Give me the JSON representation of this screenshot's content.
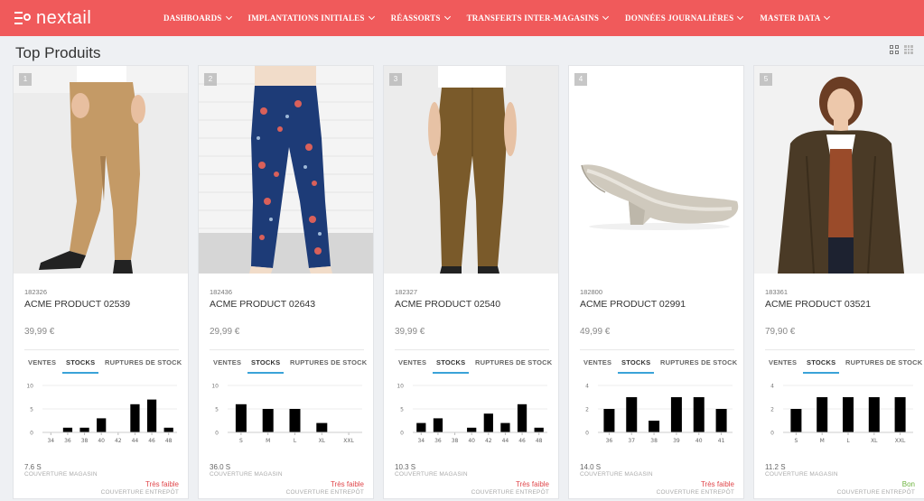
{
  "brand": {
    "name": "nextail"
  },
  "nav": [
    {
      "label": "DASHBOARDS"
    },
    {
      "label": "IMPLANTATIONS INITIALES"
    },
    {
      "label": "RÉASSORTS"
    },
    {
      "label": "TRANSFERTS INTER-MAGASINS"
    },
    {
      "label": "DONNÉES JOURNALIÈRES"
    },
    {
      "label": "MASTER DATA"
    }
  ],
  "page": {
    "title": "Top Produits"
  },
  "view_icons": [
    "grid-view-icon",
    "list-view-icon"
  ],
  "tab_labels": {
    "sales": "VENTES",
    "stocks": "STOCKS",
    "ruptures": "RUPTURES DE STOCK"
  },
  "labels": {
    "store_coverage": "COUVERTURE MAGASIN",
    "warehouse_coverage": "COUVERTURE ENTREPÔT"
  },
  "colors": {
    "brand": "#f05a5b",
    "tab_active": "#3aa3d8",
    "status_low": "#e0474b",
    "status_good": "#6db33f"
  },
  "products": [
    {
      "rank": "1",
      "sku": "182326",
      "name": "ACME PRODUCT 02539",
      "price": "39,99 €",
      "coverage": "7.6 S",
      "status": "Très faible",
      "status_color": "#e0474b"
    },
    {
      "rank": "2",
      "sku": "182436",
      "name": "ACME PRODUCT 02643",
      "price": "29,99 €",
      "coverage": "36.0 S",
      "status": "Très faible",
      "status_color": "#e0474b"
    },
    {
      "rank": "3",
      "sku": "182327",
      "name": "ACME PRODUCT 02540",
      "price": "39,99 €",
      "coverage": "10.3 S",
      "status": "Très faible",
      "status_color": "#e0474b"
    },
    {
      "rank": "4",
      "sku": "182800",
      "name": "ACME PRODUCT 02991",
      "price": "49,99 €",
      "coverage": "14.0 S",
      "status": "Très faible",
      "status_color": "#e0474b"
    },
    {
      "rank": "5",
      "sku": "183361",
      "name": "ACME PRODUCT 03521",
      "price": "79,90 €",
      "coverage": "11.2 S",
      "status": "Bon",
      "status_color": "#6db33f"
    }
  ],
  "chart_data": [
    {
      "type": "bar",
      "title": "",
      "categories": [
        "34",
        "36",
        "38",
        "40",
        "42",
        "44",
        "46",
        "48"
      ],
      "values": [
        0,
        1,
        1,
        3,
        0,
        6,
        7,
        1
      ],
      "ylim": [
        0,
        10
      ],
      "yticks": [
        0,
        5,
        10
      ]
    },
    {
      "type": "bar",
      "title": "",
      "categories": [
        "S",
        "M",
        "L",
        "XL",
        "XXL"
      ],
      "values": [
        6,
        5,
        5,
        2,
        0
      ],
      "ylim": [
        0,
        10
      ],
      "yticks": [
        0,
        5,
        10
      ]
    },
    {
      "type": "bar",
      "title": "",
      "categories": [
        "34",
        "36",
        "38",
        "40",
        "42",
        "44",
        "46",
        "48"
      ],
      "values": [
        2,
        3,
        0,
        1,
        4,
        2,
        6,
        1
      ],
      "ylim": [
        0,
        10
      ],
      "yticks": [
        0,
        5,
        10
      ]
    },
    {
      "type": "bar",
      "title": "",
      "categories": [
        "36",
        "37",
        "38",
        "39",
        "40",
        "41"
      ],
      "values": [
        2,
        3,
        1,
        3,
        3,
        2
      ],
      "ylim": [
        0,
        4
      ],
      "yticks": [
        0,
        2,
        4
      ]
    },
    {
      "type": "bar",
      "title": "",
      "categories": [
        "S",
        "M",
        "L",
        "XL",
        "XXL"
      ],
      "values": [
        2,
        3,
        3,
        3,
        3
      ],
      "ylim": [
        0,
        4
      ],
      "yticks": [
        0,
        2,
        4
      ]
    }
  ]
}
